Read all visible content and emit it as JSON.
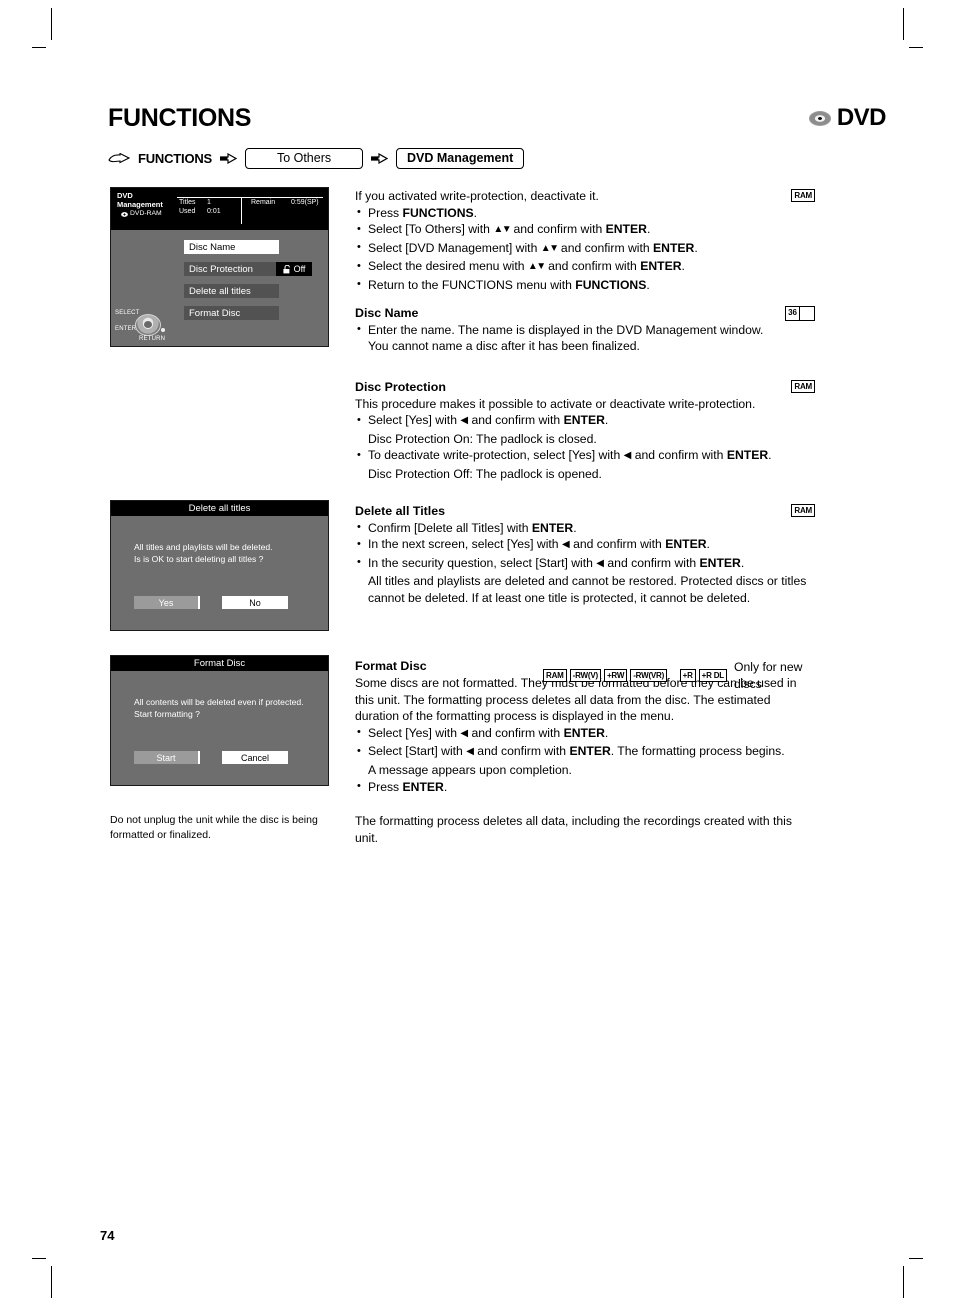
{
  "page": {
    "title": "FUNCTIONS",
    "number": "74",
    "logo": {
      "disc_icon": "dvd-disc-icon",
      "label": "DVD"
    }
  },
  "breadcrumb": {
    "hand_icon": "pointing-hand-icon",
    "root_label": "FUNCTIONS",
    "arrow_icon": "arrow-right-icon",
    "step1": "To Others",
    "step2": "DVD Management"
  },
  "screens": {
    "dvd_management": {
      "title_line1": "DVD",
      "title_line2": "Management",
      "media_label": "DVD-RAM",
      "disc_icon": "mini-disc-icon",
      "info": {
        "titles_label": "Titles",
        "titles_value": "1",
        "used_label": "Used",
        "used_value": "0:01",
        "remain_label": "Remain",
        "remain_value": "0:59(SP)"
      },
      "menu": [
        {
          "label": "Disc Name",
          "state": "selected"
        },
        {
          "label": "Disc Protection",
          "state": "normal",
          "value": "Off",
          "icon": "padlock-open-icon"
        },
        {
          "label": "Delete all titles",
          "state": "normal"
        },
        {
          "label": "Format Disc",
          "state": "normal"
        }
      ],
      "dpad": {
        "select_label": "SELECT",
        "enter_label": "ENTER",
        "return_label": "RETURN",
        "icon": "dpad-icon"
      }
    },
    "delete_all_titles": {
      "title": "Delete all titles",
      "line1": "All titles and playlists will be deleted.",
      "line2": "Is is OK to start deleting all titles ?",
      "button_yes": "Yes",
      "button_no": "No"
    },
    "format_disc": {
      "title": "Format Disc",
      "line1": "All contents will be deleted even if protected.",
      "line2": "Start formatting ?",
      "button_start": "Start",
      "button_cancel": "Cancel"
    }
  },
  "sections": {
    "intro": {
      "badge": "RAM",
      "lead": "If you activated write-protection, deactivate it.",
      "bullets": [
        {
          "pre": "Press ",
          "bold1": "FUNCTIONS",
          "post": "."
        },
        {
          "pre": "Select [To Others] with ",
          "arrows": "updown",
          "mid": " and confirm with ",
          "bold1": "ENTER",
          "post": "."
        },
        {
          "pre": "Select [DVD Management] with ",
          "arrows": "updown",
          "mid": " and confirm with ",
          "bold1": "ENTER",
          "post": "."
        },
        {
          "pre": "Select the desired menu with ",
          "arrows": "updown",
          "mid": " and confirm with ",
          "bold1": "ENTER",
          "post": "."
        },
        {
          "pre": "Return to the FUNCTIONS menu with ",
          "bold1": "FUNCTIONS",
          "post": "."
        }
      ]
    },
    "disc_name": {
      "heading": "Disc Name",
      "page_ref": "36",
      "bullets": [
        {
          "text": "Enter the name. The name is displayed in the DVD Management window.",
          "cont": "You cannot name a disc after it has been finalized."
        }
      ]
    },
    "disc_protection": {
      "heading": "Disc Protection",
      "badge": "RAM",
      "lead": "This procedure makes it possible to activate or deactivate write-protection.",
      "bullets": [
        {
          "pre": "Select [Yes] with ",
          "arrows": "left",
          "mid": " and confirm with ",
          "bold1": "ENTER",
          "post": ".",
          "cont": "Disc Protection On: The padlock is closed."
        },
        {
          "pre": "To deactivate write-protection, select [Yes] with ",
          "arrows": "left",
          "mid": " and confirm with ",
          "bold1": "ENTER",
          "post": ".",
          "cont": "Disc Protection Off: The padlock is opened."
        }
      ]
    },
    "delete_all_titles": {
      "heading": "Delete all Titles",
      "badge": "RAM",
      "bullets": [
        {
          "pre": "Confirm [Delete all Titles] with ",
          "bold1": "ENTER",
          "post": "."
        },
        {
          "pre": "In the next screen, select [Yes] with ",
          "arrows": "left",
          "mid": " and confirm with ",
          "bold1": "ENTER",
          "post": "."
        },
        {
          "pre": "In the security question, select [Start] with ",
          "arrows": "left",
          "mid": " and confirm with ",
          "bold1": "ENTER",
          "post": ".",
          "cont": "All titles and playlists are deleted and cannot be restored. Protected discs or titles",
          "cont2": "cannot be deleted. If at least one title is protected, it cannot be deleted."
        }
      ]
    },
    "format_disc": {
      "heading": "Format Disc",
      "badges": [
        "RAM",
        "-RW(V)",
        "+RW",
        "-RW(VR)",
        "+R",
        "+R DL"
      ],
      "only_new": "Only for new discs",
      "lead1": "Some discs are not formatted. They must be formatted before they can be used in",
      "lead2": "this unit. The formatting process deletes all data from the disc. The estimated",
      "lead3": "duration of the formatting process is displayed in the menu.",
      "bullets": [
        {
          "pre": "Select [Yes] with ",
          "arrows": "left",
          "mid": " and confirm with ",
          "bold1": "ENTER",
          "post": "."
        },
        {
          "pre": "Select [Start] with ",
          "arrows": "left",
          "mid": " and confirm with ",
          "bold1": "ENTER",
          "post": ". The formatting process begins.",
          "cont": "A message appears upon completion."
        },
        {
          "pre": "Press ",
          "bold1": "ENTER",
          "post": "."
        }
      ]
    }
  },
  "notes": {
    "left": "Do not unplug the unit while the disc is being formatted or finalized.",
    "right": "The formatting process deletes all data, including the recordings created with this unit."
  }
}
